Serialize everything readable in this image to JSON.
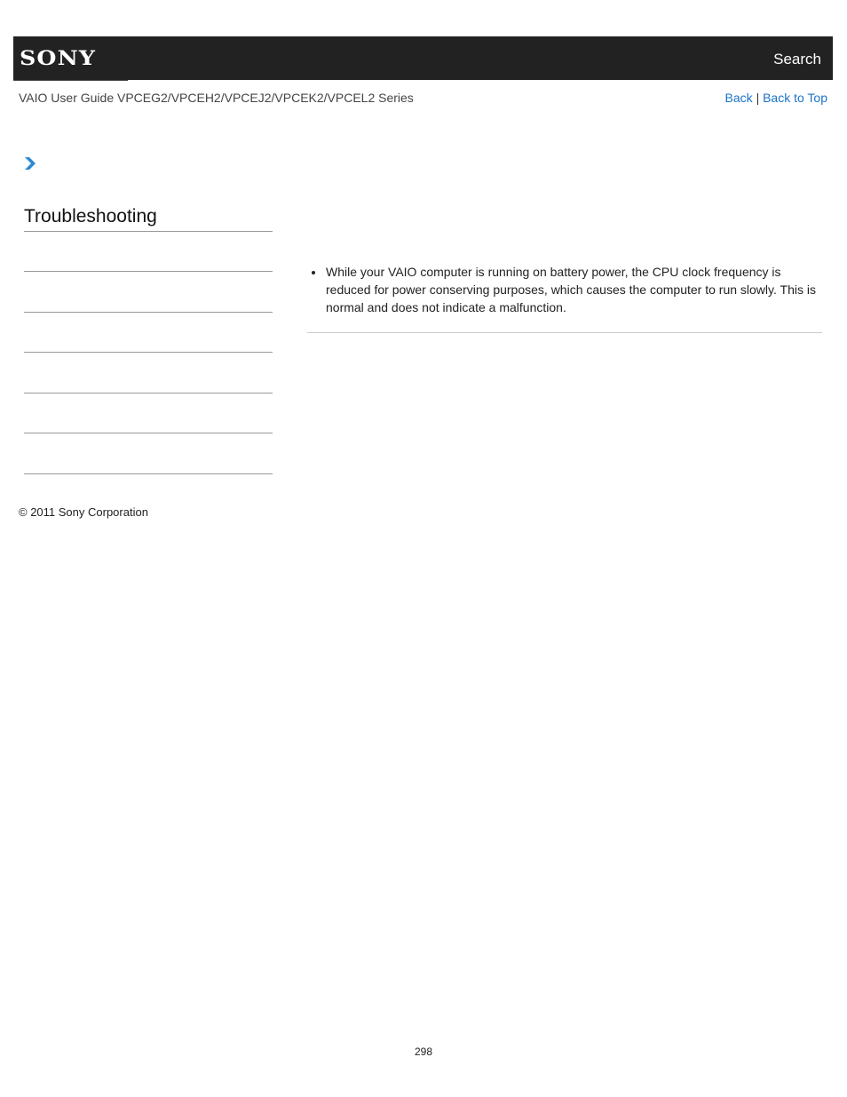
{
  "header": {
    "logo_text": "SONY",
    "search_label": "Search"
  },
  "subheader": {
    "guide_title": "VAIO User Guide VPCEG2/VPCEH2/VPCEJ2/VPCEK2/VPCEL2 Series",
    "back_label": "Back",
    "separator": "|",
    "back_to_top_label": "Back to Top"
  },
  "sidebar": {
    "chevron_icon": "chevron-right-icon",
    "accent_color": "#2a8ad4",
    "title": "Troubleshooting",
    "items": [
      "",
      "",
      "",
      "",
      "",
      ""
    ]
  },
  "main": {
    "bullets": [
      "While your VAIO computer is running on battery power, the CPU clock frequency is reduced for power conserving purposes, which causes the computer to run slowly. This is normal and does not indicate a malfunction."
    ]
  },
  "footer": {
    "copyright": "© 2011 Sony Corporation",
    "page_number": "298"
  }
}
